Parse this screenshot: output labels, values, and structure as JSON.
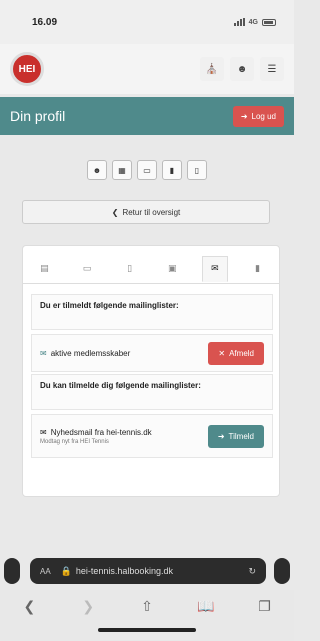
{
  "status_bar": {
    "time": "16.09",
    "signal_label": "4G"
  },
  "nav": {
    "logo_text": "HEI"
  },
  "header": {
    "title": "Din profil",
    "logout_label": "Log ud"
  },
  "back_button": {
    "label": "Retur til oversigt"
  },
  "mailing": {
    "subscribed_heading": "Du er tilmeldt følgende mailinglister:",
    "subscribed": [
      {
        "name": "aktive medlemsskaber",
        "action_label": "Afmeld"
      }
    ],
    "available_heading": "Du kan tilmelde dig følgende mailinglister:",
    "available": [
      {
        "name": "Nyhedsmail fra hei-tennis.dk",
        "desc": "Modtag nyt fra HEI Tennis",
        "action_label": "Tilmeld"
      }
    ]
  },
  "browser": {
    "aa_label": "AA",
    "url": "hei-tennis.halbooking.dk"
  },
  "colors": {
    "teal": "#4f8a8b",
    "red": "#d9534f"
  }
}
